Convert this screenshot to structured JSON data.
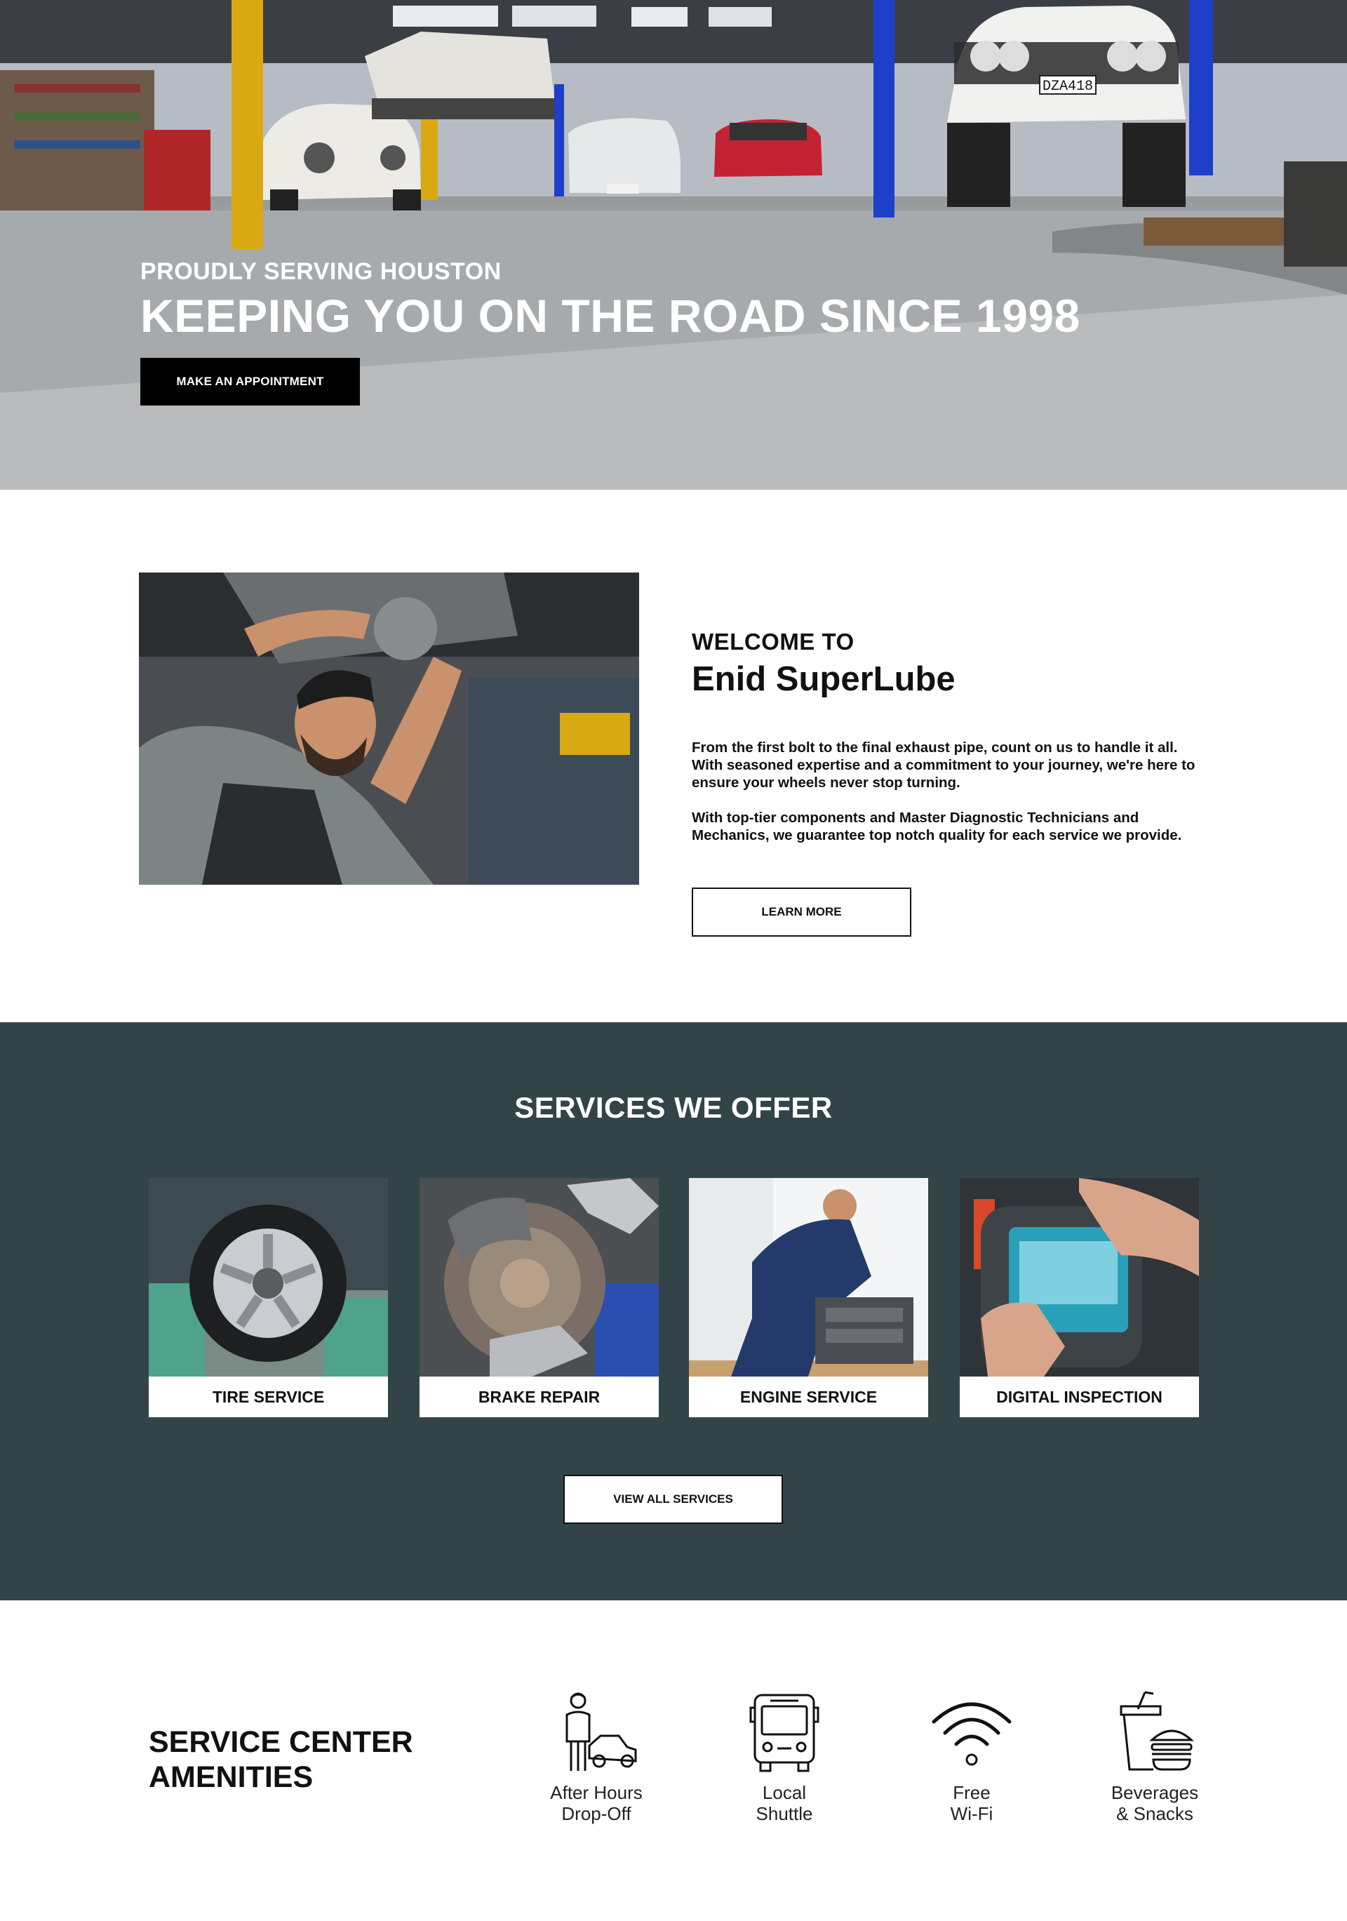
{
  "hero": {
    "subtitle": "PROUDLY SERVING HOUSTON",
    "title": "KEEPING YOU ON THE ROAD SINCE 1998",
    "cta_label": "MAKE AN APPOINTMENT",
    "plate_text": "DZA418"
  },
  "welcome": {
    "pre_title": "WELCOME TO",
    "title": "Enid SuperLube",
    "paragraph_1": "From the first bolt to the final exhaust pipe, count on us to handle it all. With seasoned expertise and a commitment to your journey, we're here to ensure your wheels never stop turning.",
    "paragraph_2": "With top-tier components and Master Diagnostic Technicians and Mechanics, we guarantee top notch quality for each service we provide.",
    "cta_label": "LEARN MORE"
  },
  "services": {
    "title": "SERVICES WE OFFER",
    "cards": [
      {
        "label": "TIRE SERVICE"
      },
      {
        "label": "BRAKE REPAIR"
      },
      {
        "label": "ENGINE SERVICE"
      },
      {
        "label": "DIGITAL INSPECTION"
      }
    ],
    "cta_label": "VIEW ALL SERVICES"
  },
  "amenities": {
    "title": "SERVICE CENTER AMENITIES",
    "items": [
      {
        "line1": "After Hours",
        "line2": "Drop-Off",
        "icon": "mechanic-car-icon"
      },
      {
        "line1": "Local",
        "line2": "Shuttle",
        "icon": "bus-icon"
      },
      {
        "line1": "Free",
        "line2": "Wi-Fi",
        "icon": "wifi-icon"
      },
      {
        "line1": "Beverages",
        "line2": "& Snacks",
        "icon": "drink-burger-icon"
      }
    ]
  },
  "colors": {
    "services_bg": "#334449",
    "button_dark": "#000000",
    "text": "#111111"
  }
}
